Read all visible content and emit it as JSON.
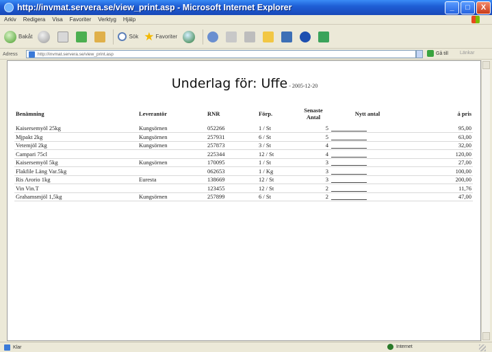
{
  "window": {
    "title": "http://invmat.servera.se/view_print.asp - Microsoft Internet Explorer",
    "controls": [
      "_",
      "□",
      "X"
    ]
  },
  "menu": [
    "Arkiv",
    "Redigera",
    "Visa",
    "Favoriter",
    "Verktyg",
    "Hjälp"
  ],
  "toolbar": {
    "back": "Bakåt",
    "search": "Sök",
    "favorites": "Favoriter"
  },
  "address": {
    "label": "Adress",
    "url": "http://invmat.servera.se/view_print.asp",
    "go": "Gå till",
    "links": "Länkar"
  },
  "page": {
    "heading": "Underlag för: Uffe",
    "date": " - 2005-12-20",
    "columns": {
      "name": "Benämning",
      "supplier": "Leverantör",
      "rnr": "RNR",
      "unit": "Förp.",
      "last_qty": "Senaste Antal",
      "new_qty": "Nytt antal",
      "price": "á pris"
    },
    "rows": [
      {
        "name": "Kaisersemyöl 25kg",
        "supplier": "Kungsörnen",
        "rnr": "052266",
        "unit": "1 / St",
        "last": "5",
        "price": "95,00"
      },
      {
        "name": "Mjpakt 2kg",
        "supplier": "Kungsörnen",
        "rnr": "257931",
        "unit": "6 / St",
        "last": "5",
        "price": "63,00"
      },
      {
        "name": "Vetemjöl 2kg",
        "supplier": "Kungsörnen",
        "rnr": "257873",
        "unit": "3 / St",
        "last": "4",
        "price": "32,00"
      },
      {
        "name": "Campari 75cl",
        "supplier": "",
        "rnr": "225344",
        "unit": "12 / St",
        "last": "4",
        "price": "120,00"
      },
      {
        "name": "Kaisersemyöl 5kg",
        "supplier": "Kungsörnen",
        "rnr": "170095",
        "unit": "1 / St",
        "last": "3",
        "price": "27,00"
      },
      {
        "name": "Flakfile Läng Var.5kg",
        "supplier": "",
        "rnr": "062653",
        "unit": "1 / Kg",
        "last": "3",
        "price": "100,00"
      },
      {
        "name": "Ris Arorio 1kg",
        "supplier": "Euresta",
        "rnr": "138669",
        "unit": "12 / St",
        "last": "3",
        "price": "200,00"
      },
      {
        "name": "Vin Vin.T",
        "supplier": "",
        "rnr": "123455",
        "unit": "12 / St",
        "last": "2",
        "price": "11,76"
      },
      {
        "name": "Grahamsmjöl 1,5kg",
        "supplier": "Kungsörnen",
        "rnr": "257899",
        "unit": "6 / St",
        "last": "2",
        "price": "47,00"
      }
    ]
  },
  "status": {
    "left": "Klar",
    "zone": "Internet"
  }
}
